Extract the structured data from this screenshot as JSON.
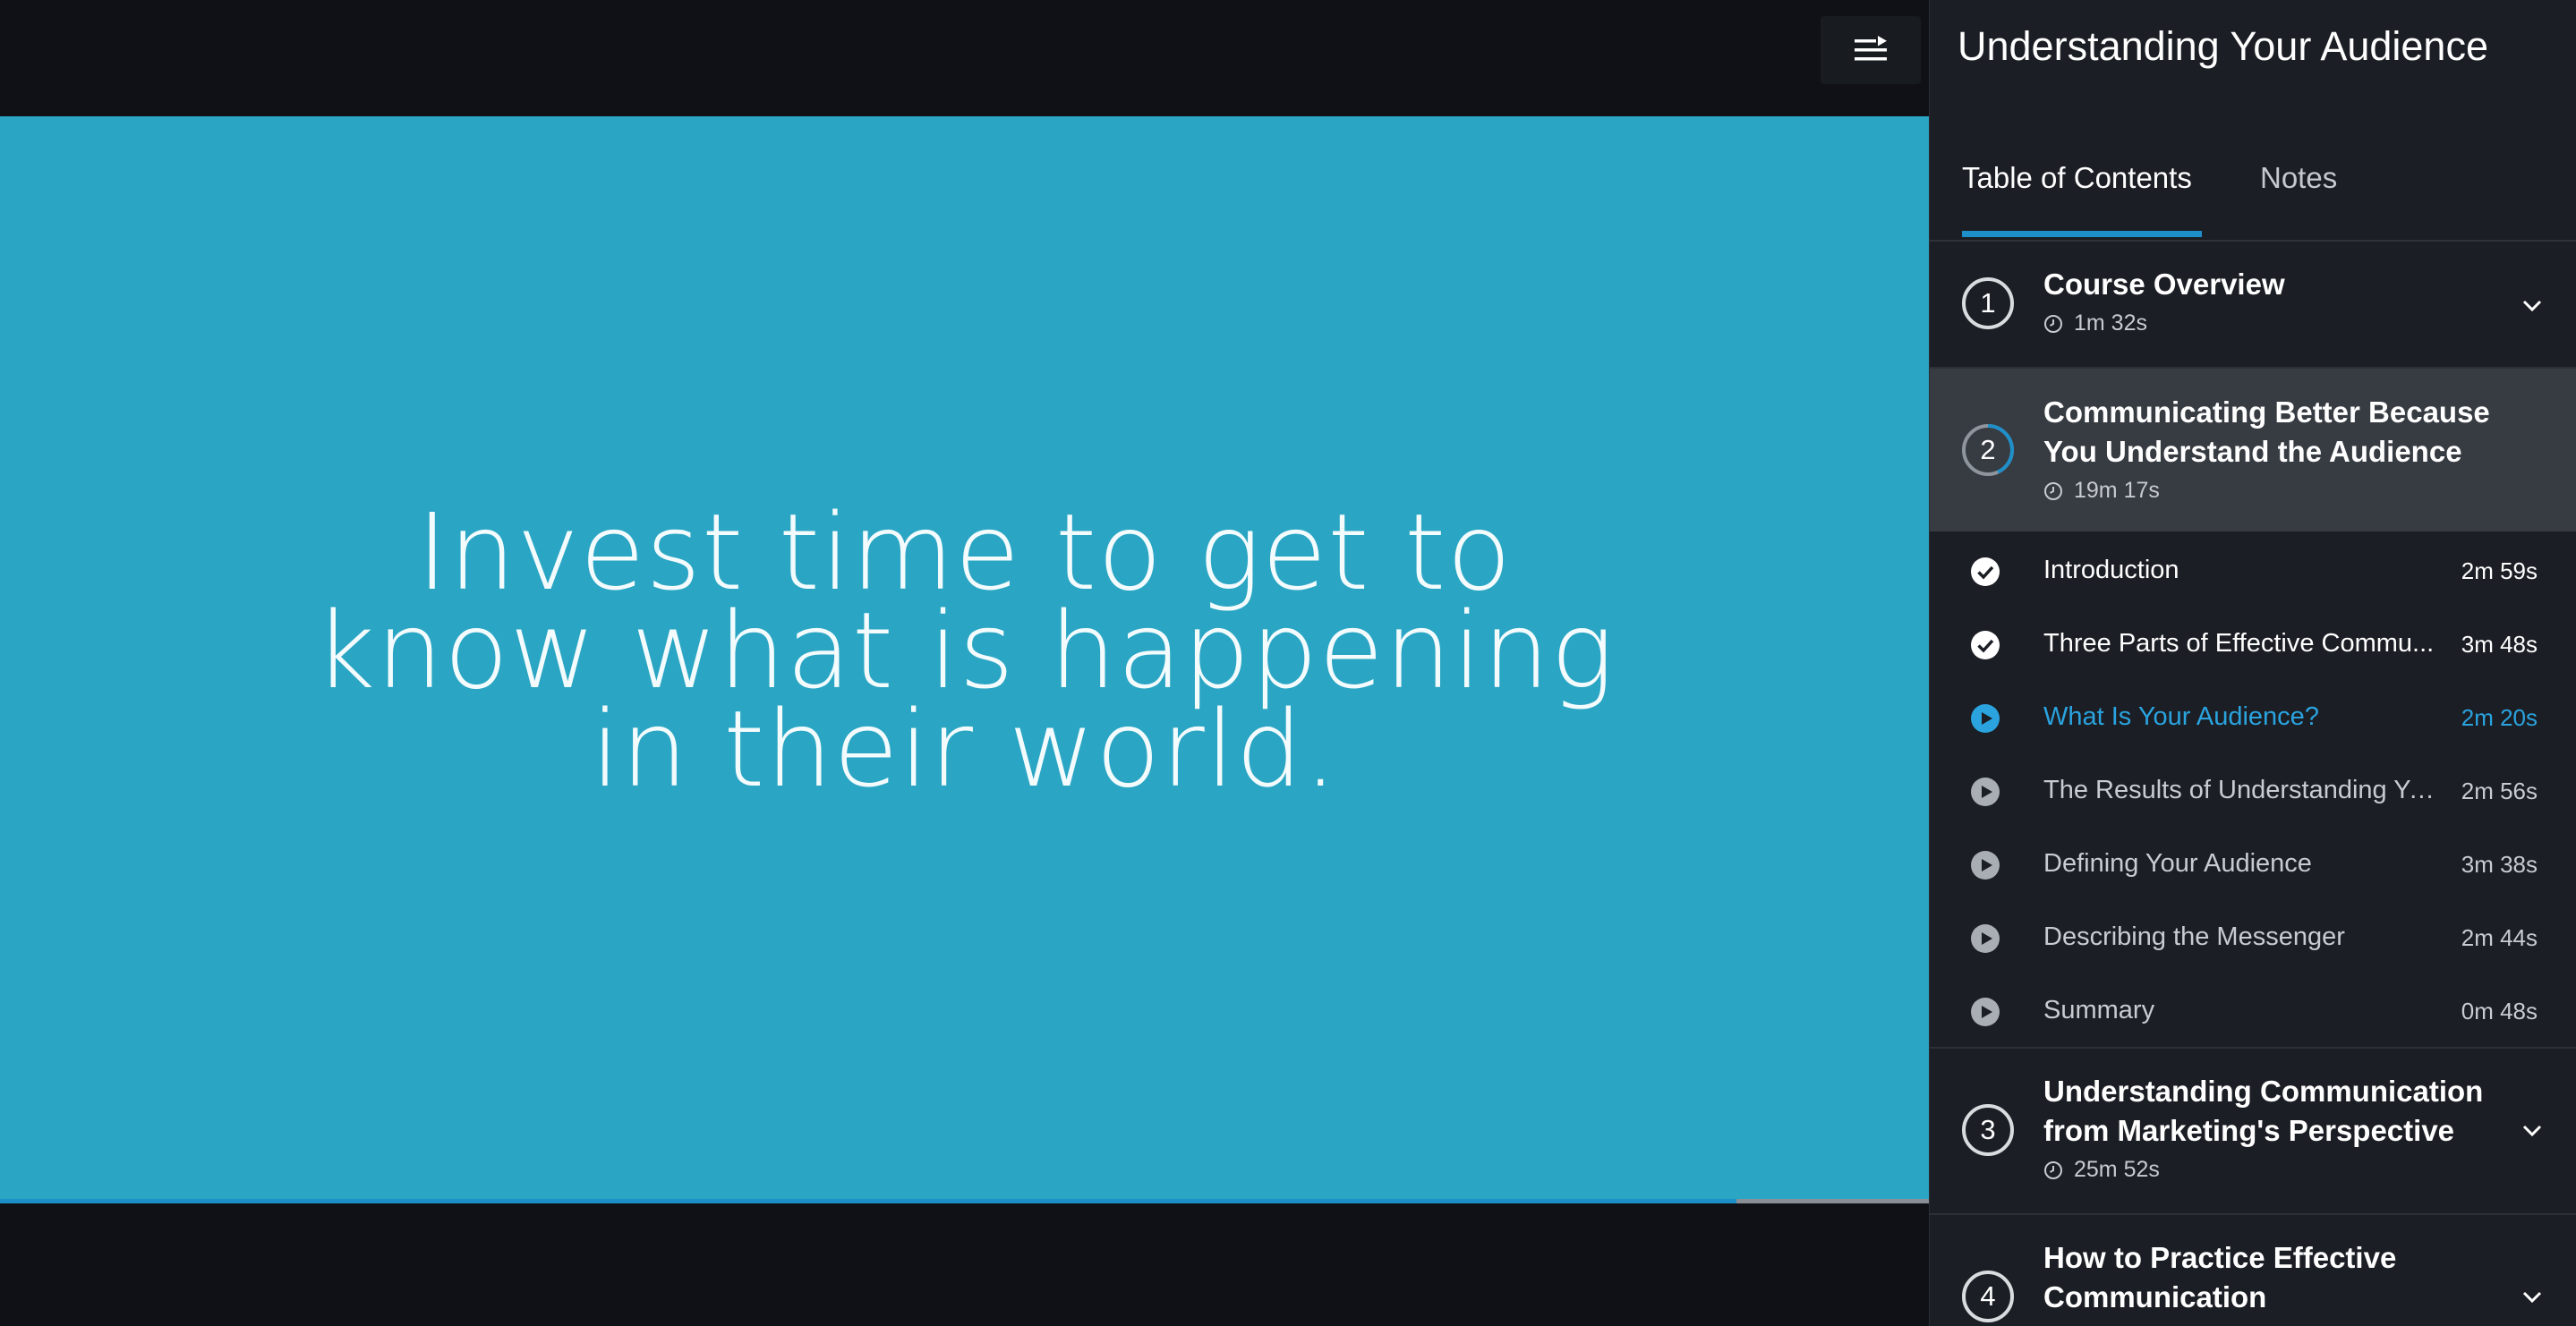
{
  "player": {
    "slide_text": "Invest time to get to know what is happening in their world.",
    "progress_fraction": 0.9,
    "icons": {
      "menu": "playlist-menu-icon",
      "watermark": "play-logo-icon"
    }
  },
  "sidebar": {
    "course_title": "Understanding Your Audience",
    "tabs": [
      {
        "label": "Table of Contents",
        "active": true
      },
      {
        "label": "Notes",
        "active": false
      }
    ],
    "modules": [
      {
        "number": "1",
        "title": "Course Overview",
        "duration": "1m 32s",
        "expanded": false
      },
      {
        "number": "2",
        "title": "Communicating Better Because You Understand the Audience",
        "duration": "19m 17s",
        "expanded": true,
        "clips": [
          {
            "title": "Introduction",
            "duration": "2m 59s",
            "status": "done"
          },
          {
            "title": "Three Parts of Effective Commu...",
            "duration": "3m 48s",
            "status": "done"
          },
          {
            "title": "What Is Your Audience?",
            "duration": "2m 20s",
            "status": "active"
          },
          {
            "title": "The Results of Understanding Yo...",
            "duration": "2m 56s",
            "status": "pending"
          },
          {
            "title": "Defining Your Audience",
            "duration": "3m 38s",
            "status": "pending"
          },
          {
            "title": "Describing the Messenger",
            "duration": "2m 44s",
            "status": "pending"
          },
          {
            "title": "Summary",
            "duration": "0m 48s",
            "status": "pending"
          }
        ]
      },
      {
        "number": "3",
        "title": "Understanding Communication from Marketing's Perspective",
        "duration": "25m 52s",
        "expanded": false
      },
      {
        "number": "4",
        "title": "How to Practice Effective Communication",
        "duration": "",
        "expanded": false
      }
    ],
    "colors": {
      "accent": "#1f8fc9",
      "active_text": "#2aa3df",
      "video_bg": "#2aa6c4",
      "sidebar_bg": "#1b1e24"
    }
  }
}
